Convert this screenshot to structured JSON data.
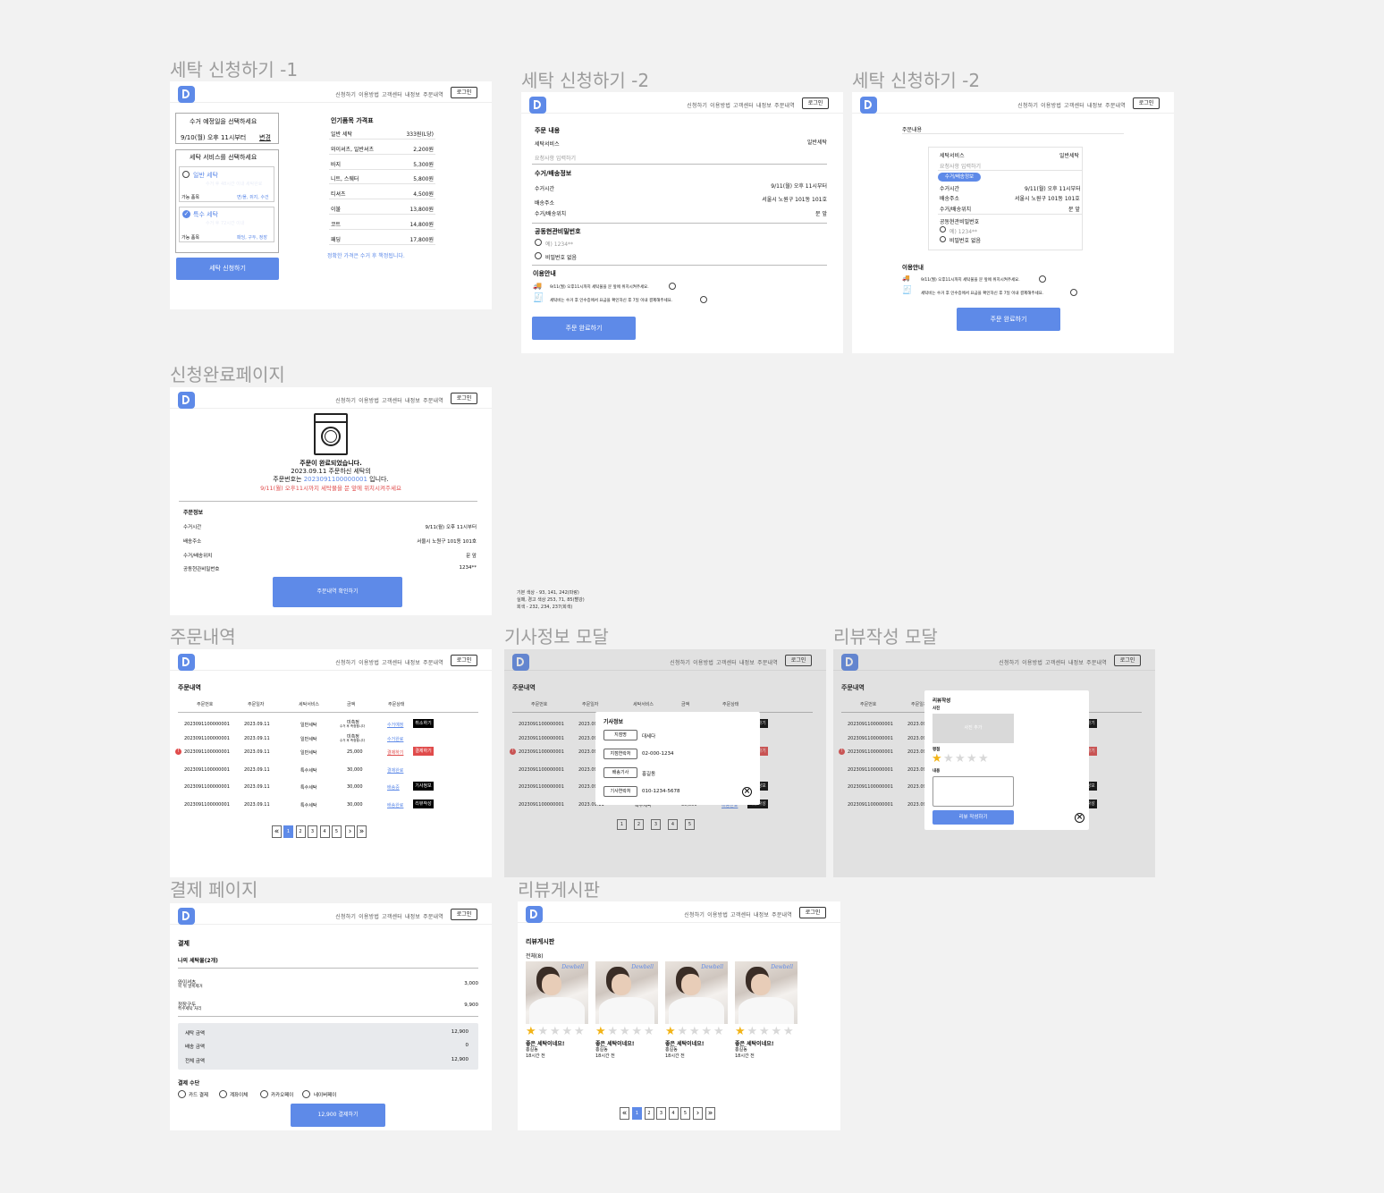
{
  "titles": {
    "apply1": "세탁 신청하기 -1",
    "apply2": "세탁 신청하기 -2",
    "apply3": "세탁 신청하기 -2",
    "done": "신청완료페이지",
    "orders": "주문내역",
    "driver": "기사정보 모달",
    "reviewModal": "리뷰작성 모달",
    "payment": "결제 페이지",
    "board": "리뷰게시판"
  },
  "nav": {
    "links": [
      "신청하기",
      "이용방법",
      "고객센터",
      "내정보",
      "주문내역"
    ],
    "login": "로그인"
  },
  "apply1": {
    "pickup_title": "수거 예정일을 선택하세요",
    "pickup_date": "9/10(월) 오후 11시부터",
    "change": "변경",
    "service_title": "세탁 서비스를 선택하세요",
    "general": "일반 세탁",
    "general_sub": "수거 후 48시간 이내 세탁완료",
    "avail": "가능 품목",
    "general_items": "면/폴, 쥐지, 수건",
    "special": "특수 세탁",
    "special_sub": "수거 후 72시간 이내",
    "special_items": "패딩, 구두, 정장",
    "submit": "세탁 신청하기",
    "price_title": "인기품목 가격표",
    "prices": [
      [
        "일반 세탁",
        "333원(L당)"
      ],
      [
        "와이셔츠, 일반셔츠",
        "2,200원"
      ],
      [
        "바지",
        "5,300원"
      ],
      [
        "니트, 스웨터",
        "5,800원"
      ],
      [
        "티셔츠",
        "4,500원"
      ],
      [
        "이불",
        "13,800원"
      ],
      [
        "코트",
        "14,800원"
      ],
      [
        "패딩",
        "17,800원"
      ]
    ],
    "price_note": "정확한 가격은 수거 후 책정됩니다."
  },
  "apply2": {
    "order_title": "주문 내용",
    "service_label": "세탁서비스",
    "service_val": "일반세탁",
    "request_ph": "요청사항 입력하기",
    "pickup_title": "수거/배송정보",
    "rows": [
      [
        "수거시간",
        "9/11(월) 오후 11시부터"
      ],
      [
        "배송주소",
        "서울시 노원구 101동 101호"
      ],
      [
        "수거/배송위치",
        "문 앞"
      ]
    ],
    "door_title": "공동현관비밀번호",
    "door_ph": "예) 1234**",
    "no_pw": "비밀번호 없음",
    "guide_title": "이용안내",
    "guide1": "9/11(월) 오후11시까지 세탁물을 문 앞에 위치시켜주세요.",
    "guide2": "세탁비는 수거 후 인수증에서 요금을 확인하신 후 7일 이내 결제해주세요.",
    "submit": "주문 완료하기"
  },
  "apply3": {
    "tab": "주문내용",
    "service_label": "세탁서비스",
    "service_val": "일반세탁",
    "request_ph": "요청사항 입력하기",
    "pickup_tag": "수거/배송정보",
    "rows": [
      [
        "수거시간",
        "9/11(월) 오후 11시부터"
      ],
      [
        "배송주소",
        "서울시 노원구 101동 101호"
      ],
      [
        "수거/배송위치",
        "문 앞"
      ]
    ],
    "door_title": "공동현관비밀번호",
    "door_ph": "예) 1234**",
    "no_pw": "비밀번호 없음",
    "guide_title": "이용안내",
    "guide1": "9/11(월) 오후11시까지 세탁물을 문 앞에 위치시켜주세요.",
    "guide2": "세탁비는 수거 후 인수증에서 요금을 확인하신 후 7일 이내 결제해주세요.",
    "submit": "주문 완료하기"
  },
  "done": {
    "l1": "주문이 완료되었습니다.",
    "l2": "2023.09.11 주문하신 세탁의",
    "l3a": "주문번호는 ",
    "l3b": "2023091100000001",
    "l3c": " 입니다.",
    "l4": "9/11(월) 오후11시까지 세탁물을 문 앞에 위치시켜주세요",
    "info_title": "주문정보",
    "rows": [
      [
        "수거시간",
        "9/11(월) 오후 11시부터"
      ],
      [
        "배송주소",
        "서울시 노원구 101동 101호"
      ],
      [
        "수거/배송위치",
        "문 앞"
      ],
      [
        "공동현관비밀번호",
        "1234**"
      ]
    ],
    "btn": "주문내역 확인하기"
  },
  "colornote": [
    "기본 색상 - 93, 141, 242(파랑)",
    "실패, 경고 색상 253, 71, 85(빨강)",
    "회색 - 232, 234, 237(회색)"
  ],
  "orders": {
    "title": "주문내역",
    "headers": [
      "주문번호",
      "주문일자",
      "세탁서비스",
      "금액",
      "주문상태"
    ],
    "rows": [
      [
        "2023091100000001",
        "2023.09.11",
        "일반세탁",
        "미측정",
        "수거 후 측정됩니다",
        "수거예정",
        "취소하기"
      ],
      [
        "2023091100000001",
        "2023.09.11",
        "일반세탁",
        "미측정",
        "수거 후 측정됩니다",
        "수거완료",
        ""
      ],
      [
        "2023091100000001",
        "2023.09.11",
        "일반세탁",
        "25,000",
        "",
        "결제하기",
        "결제하기"
      ],
      [
        "2023091100000001",
        "2023.09.11",
        "특수세탁",
        "30,000",
        "",
        "결제완료",
        ""
      ],
      [
        "2023091100000001",
        "2023.09.11",
        "특수세탁",
        "30,000",
        "",
        "배송중",
        "기사정보"
      ],
      [
        "2023091100000001",
        "2023.09.11",
        "특수세탁",
        "30,000",
        "",
        "배송완료",
        "리뷰작성"
      ]
    ],
    "pages": [
      "1",
      "2",
      "3",
      "4",
      "5"
    ]
  },
  "driver": {
    "title": "기사정보",
    "rows": [
      [
        "지점명",
        "대세다"
      ],
      [
        "지점연락처",
        "02-000-1234"
      ],
      [
        "배송기사",
        "홍길동"
      ],
      [
        "기사연락처",
        "010-1234-5678"
      ]
    ],
    "pages": [
      "1",
      "2",
      "3",
      "4",
      "5"
    ]
  },
  "reviewModal": {
    "title": "리뷰작성",
    "photo": "사진",
    "photo_ph": "사진 추가",
    "rating": "평점",
    "content": "내용",
    "submit": "리뷰 작성하기"
  },
  "payment": {
    "title": "결제",
    "my": "나의 세탁물(2개)",
    "items": [
      [
        "와이셔츠",
        "목 뒤 얼룩제거",
        "3,000"
      ],
      [
        "정장구두",
        "특수세탁 처리",
        "9,900"
      ]
    ],
    "sums": [
      [
        "세탁 금액",
        "12,900"
      ],
      [
        "배송 금액",
        "0"
      ],
      [
        "전체 금액",
        "12,900"
      ]
    ],
    "method_title": "결제 수단",
    "methods": [
      "카드 결제",
      "계좌이체",
      "카카오페이",
      "네이버페이"
    ],
    "btn": "12,900 결제하기"
  },
  "board": {
    "title": "리뷰게시판",
    "count": "전체(8)",
    "brand": "Dewbell",
    "cards": [
      {
        "text": "좋은 세탁이네요!",
        "name": "홍길동",
        "time": "18시간 전"
      },
      {
        "text": "좋은 세탁이네요!",
        "name": "홍길동",
        "time": "18시간 전"
      },
      {
        "text": "좋은 세탁이네요!",
        "name": "홍길동",
        "time": "18시간 전"
      },
      {
        "text": "좋은 세탁이네요!",
        "name": "홍길동",
        "time": "18시간 전"
      }
    ],
    "pages": [
      "1",
      "2",
      "3",
      "4",
      "5"
    ]
  },
  "colors": {
    "primary": "#5e8ae8",
    "warn": "#e04b4b",
    "gray": "#e8eaed"
  }
}
